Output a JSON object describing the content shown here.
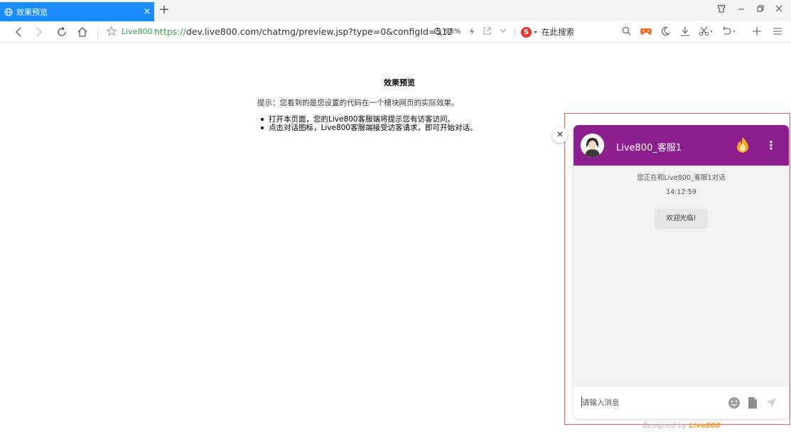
{
  "browser": {
    "tab_title": "效果预览",
    "tab_close": "×",
    "new_tab": "+",
    "site_name": "Live800",
    "url_protocol": "https://",
    "url_rest": "dev.live800.com/chatmg/preview.jsp?type=0&configId=512",
    "zoom_level": "95%",
    "search_placeholder": "在此搜索",
    "search_engine_letter": "S"
  },
  "page": {
    "title": "效果预览",
    "hint": "提示：您看到的是您设置的代码在一个模块网页的实际效果。",
    "bullets": [
      "打开本页面，您的Live800客服端将提示您有访客访问。",
      "点击对话图标，Live800客服端接受访客请求，即可开始对话。"
    ]
  },
  "chat": {
    "agent_name": "Live800_客服1",
    "status": "您正在和Live800_客服1对话",
    "time": "14:12:59",
    "welcome_message": "欢迎光临!",
    "input_placeholder": "请输入消息",
    "close_symbol": "×",
    "more_symbol": "⋮",
    "header_color": "#8c1e8e"
  },
  "footer": {
    "designed_by": "Designed by ",
    "brand": "Live800"
  }
}
